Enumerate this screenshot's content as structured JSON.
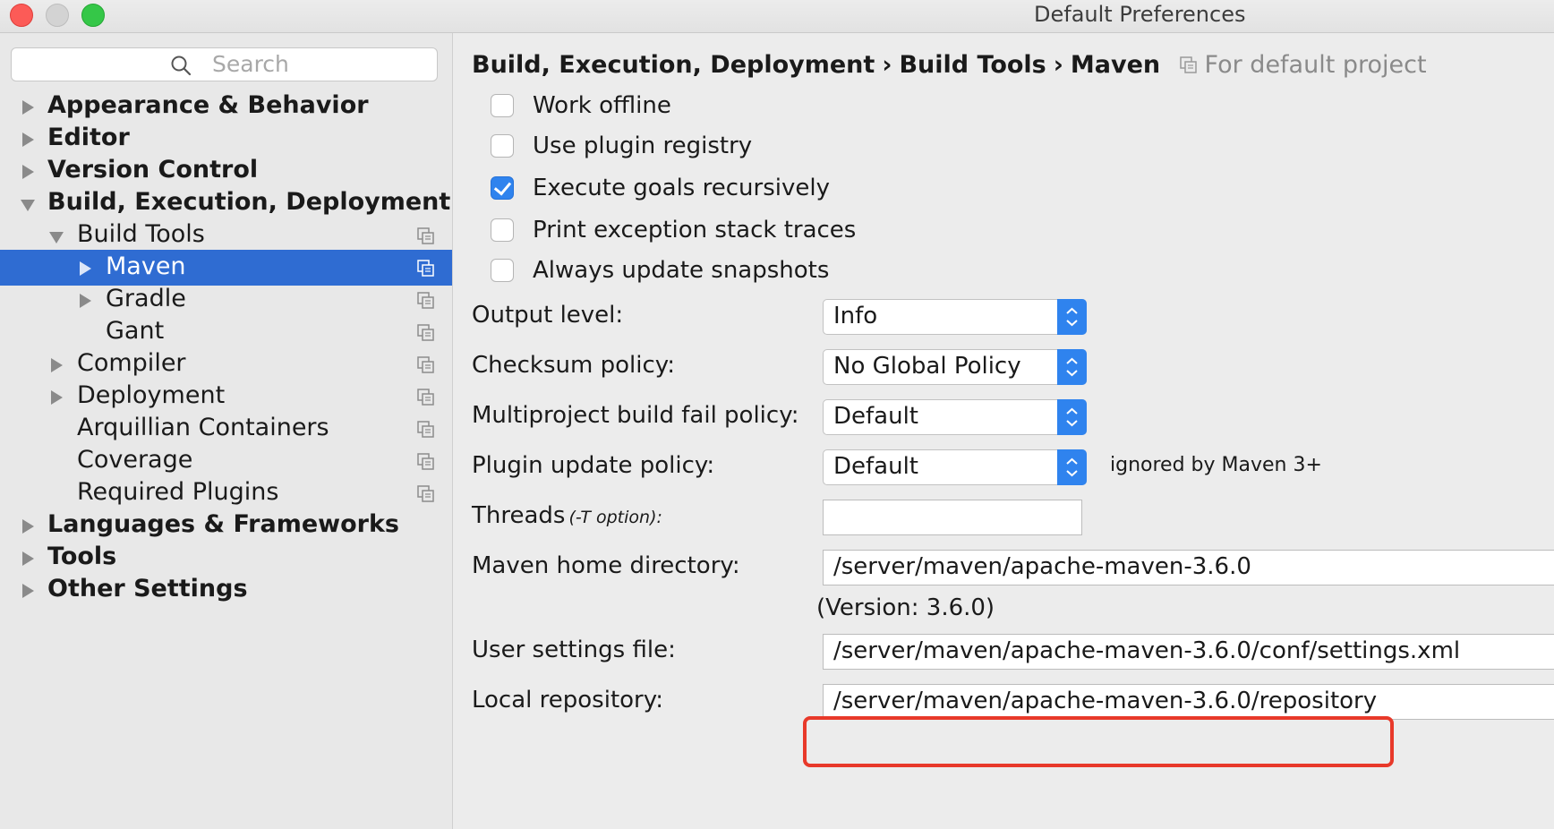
{
  "window": {
    "title": "Default Preferences",
    "buttons": [
      "close",
      "minimize",
      "zoom"
    ]
  },
  "colors": {
    "selection": "#2f6cd2",
    "accent": "#2f83ee",
    "highlight": "#e8392a"
  },
  "sidebar": {
    "search_placeholder": "Search",
    "items": [
      {
        "label": "Appearance & Behavior",
        "arrow": "right",
        "selected": false,
        "copy_icon": false
      },
      {
        "label": "Editor",
        "arrow": "right",
        "selected": false,
        "copy_icon": false
      },
      {
        "label": "Version Control",
        "arrow": "right",
        "selected": false,
        "copy_icon": false
      },
      {
        "label": "Build, Execution, Deployment",
        "arrow": "down",
        "selected": false,
        "copy_icon": false
      },
      {
        "label": "Build Tools",
        "arrow": "down",
        "selected": false,
        "copy_icon": true
      },
      {
        "label": "Maven",
        "arrow": "right",
        "selected": true,
        "copy_icon": true
      },
      {
        "label": "Gradle",
        "arrow": "right",
        "selected": false,
        "copy_icon": true
      },
      {
        "label": "Gant",
        "arrow": "none",
        "selected": false,
        "copy_icon": true
      },
      {
        "label": "Compiler",
        "arrow": "right",
        "selected": false,
        "copy_icon": true
      },
      {
        "label": "Deployment",
        "arrow": "right",
        "selected": false,
        "copy_icon": true
      },
      {
        "label": "Arquillian Containers",
        "arrow": "none",
        "selected": false,
        "copy_icon": true
      },
      {
        "label": "Coverage",
        "arrow": "none",
        "selected": false,
        "copy_icon": true
      },
      {
        "label": "Required Plugins",
        "arrow": "none",
        "selected": false,
        "copy_icon": true
      },
      {
        "label": "Languages & Frameworks",
        "arrow": "right",
        "selected": false,
        "copy_icon": false
      },
      {
        "label": "Tools",
        "arrow": "right",
        "selected": false,
        "copy_icon": false
      },
      {
        "label": "Other Settings",
        "arrow": "right",
        "selected": false,
        "copy_icon": false
      }
    ]
  },
  "main": {
    "breadcrumb": {
      "crumbs": [
        "Build, Execution, Deployment",
        "Build Tools",
        "Maven"
      ],
      "separator": "›",
      "scope": "For default project"
    },
    "checkboxes": [
      {
        "label": "Work offline",
        "checked": false
      },
      {
        "label": "Use plugin registry",
        "checked": false
      },
      {
        "label": "Execute goals recursively",
        "checked": true
      },
      {
        "label": "Print exception stack traces",
        "checked": false
      },
      {
        "label": "Always update snapshots",
        "checked": false
      }
    ],
    "combos": [
      {
        "label": "Output level:",
        "value": "Info"
      },
      {
        "label": "Checksum policy:",
        "value": "No Global Policy"
      },
      {
        "label": "Multiproject build fail policy:",
        "value": "Default"
      },
      {
        "label": "Plugin update policy:",
        "value": "Default",
        "note": "ignored by Maven 3+"
      }
    ],
    "threads": {
      "label": "Threads",
      "hint": "(-T option):",
      "value": ""
    },
    "maven_home": {
      "label": "Maven home directory:",
      "value": "/server/maven/apache-maven-3.6.0",
      "version_note": "(Version: 3.6.0)"
    },
    "user_settings": {
      "label": "User settings file:",
      "value": "/server/maven/apache-maven-3.6.0/conf/settings.xml"
    },
    "local_repository": {
      "label": "Local repository:",
      "value": "/server/maven/apache-maven-3.6.0/repository"
    }
  }
}
